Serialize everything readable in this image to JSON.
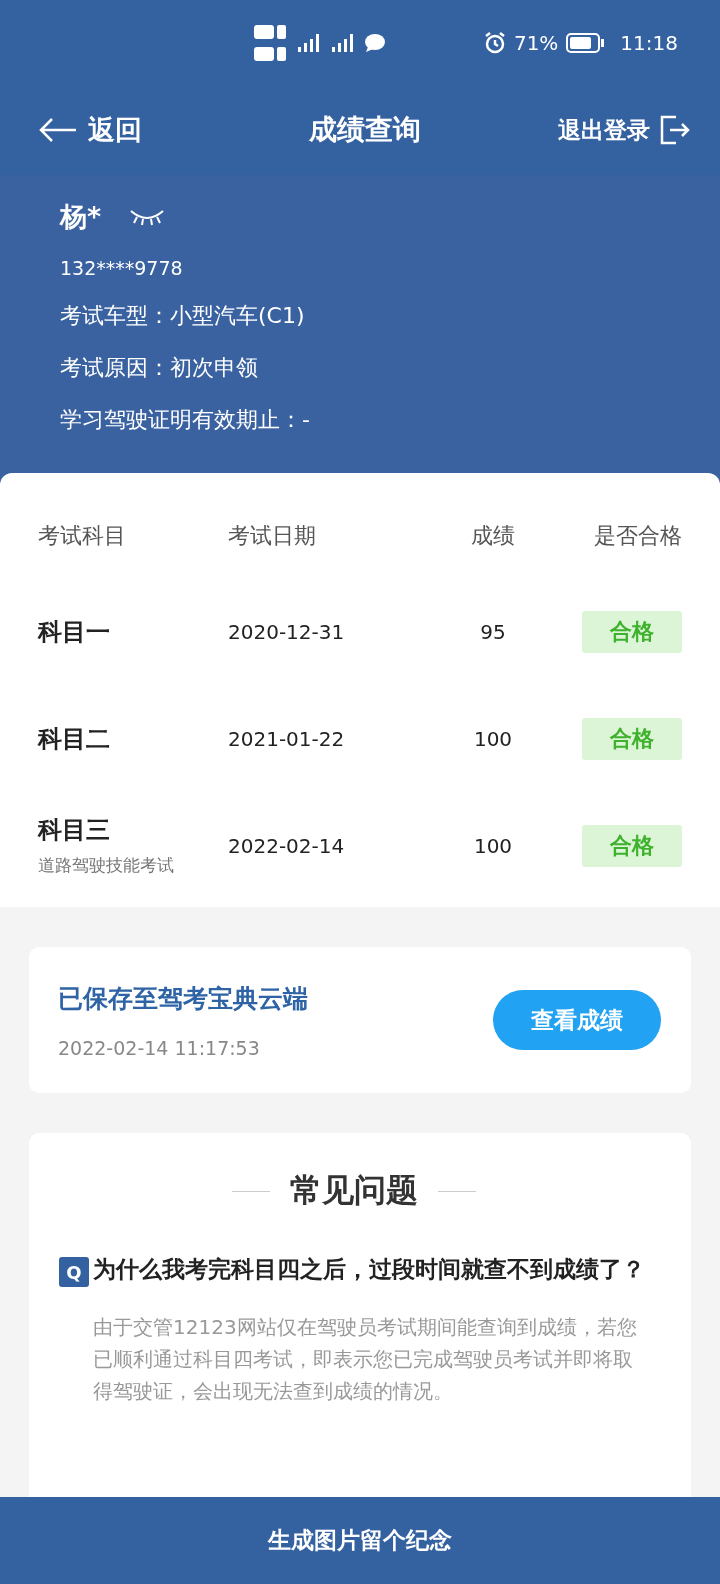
{
  "status_bar": {
    "battery": "71%",
    "time": "11:18"
  },
  "nav": {
    "back": "返回",
    "title": "成绩查询",
    "logout": "退出登录"
  },
  "profile": {
    "name": "杨*",
    "phone": "132****9778",
    "lines": [
      "考试车型：小型汽车(C1)",
      "考试原因：初次申领",
      "学习驾驶证明有效期止：-"
    ]
  },
  "table": {
    "columns": [
      "考试科目",
      "考试日期",
      "成绩",
      "是否合格"
    ],
    "rows": [
      {
        "subject": "科目一",
        "date": "2020-12-31",
        "score": "95",
        "result": "合格",
        "passed": true
      },
      {
        "subject": "科目二",
        "date": "2021-01-22",
        "score": "100",
        "result": "合格",
        "passed": true
      },
      {
        "subject": "科目三",
        "note": "道路驾驶技能考试",
        "date": "2022-02-14",
        "score": "100",
        "result": "合格",
        "passed": true
      }
    ]
  },
  "cloud": {
    "title": "已保存至驾考宝典云端",
    "time": "2022-02-14 11:17:53",
    "button": "查看成绩"
  },
  "faq": {
    "title": "常见问题",
    "items": [
      {
        "mark": "Q",
        "question": "为什么我考完科目四之后，过段时间就查不到成绩了？",
        "answer": "由于交管12123网站仅在驾驶员考试期间能查询到成绩，若您已顺利通过科目四考试，即表示您已完成驾驶员考试并即将取得驾驶证，会出现无法查到成绩的情况。"
      }
    ]
  },
  "bottom_button": "生成图片留个纪念"
}
